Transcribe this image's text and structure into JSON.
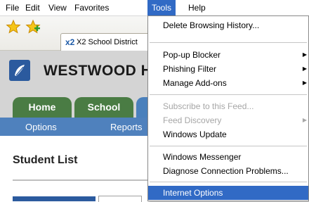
{
  "menubar": {
    "file": "File",
    "edit": "Edit",
    "view": "View",
    "favorites": "Favorites",
    "tools": "Tools",
    "help": "Help"
  },
  "toolbar": {
    "tab_icon": "x2",
    "tab_title": "X2 School District"
  },
  "page": {
    "school_name": "WESTWOOD H",
    "nav_home": "Home",
    "nav_school": "School",
    "sub_options": "Options",
    "sub_reports": "Reports",
    "title": "Student List"
  },
  "tools_menu": {
    "delete_history": "Delete Browsing History...",
    "popup_blocker": "Pop-up Blocker",
    "phishing_filter": "Phishing Filter",
    "manage_addons": "Manage Add-ons",
    "subscribe_feed": "Subscribe to this Feed...",
    "feed_discovery": "Feed Discovery",
    "windows_update": "Windows Update",
    "windows_messenger": "Windows Messenger",
    "diagnose": "Diagnose Connection Problems...",
    "internet_options": "Internet Options"
  },
  "icons": {
    "favorites_star": "star-icon",
    "add_favorite": "add-favorite-star-icon",
    "submenu_arrow": "chevron-right-icon",
    "logo": "school-logo-icon"
  },
  "colors": {
    "menu_highlight": "#316ac5",
    "nav_green": "#4a7c44",
    "subnav_blue": "#4f81bd"
  }
}
